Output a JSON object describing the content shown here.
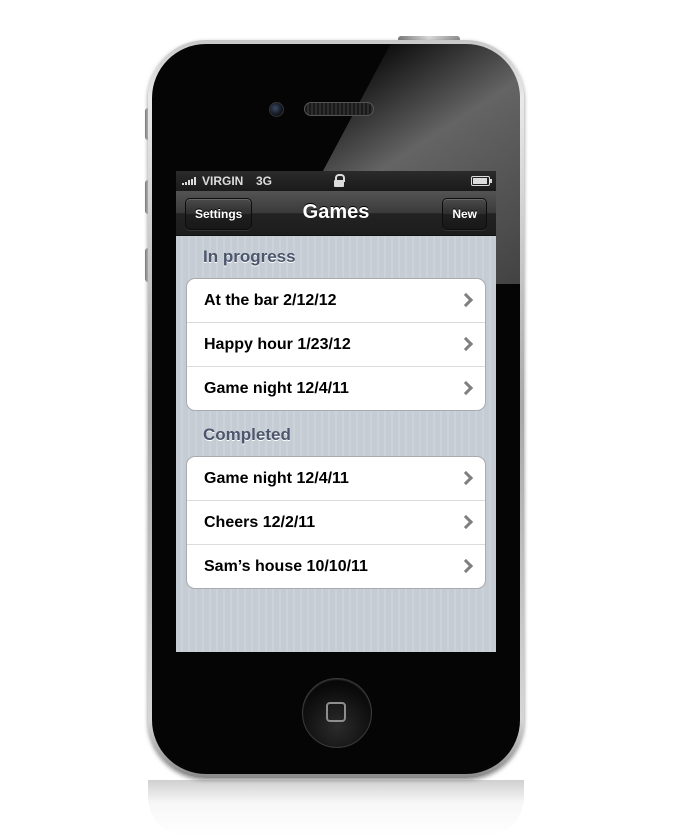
{
  "status_bar": {
    "carrier": "VIRGIN",
    "network": "3G"
  },
  "nav_bar": {
    "title": "Games",
    "left_button": "Settings",
    "right_button": "New"
  },
  "sections": [
    {
      "header": "In progress",
      "rows": [
        {
          "label": "At the bar 2/12/12"
        },
        {
          "label": "Happy hour 1/23/12"
        },
        {
          "label": "Game night 12/4/11"
        }
      ]
    },
    {
      "header": "Completed",
      "rows": [
        {
          "label": "Game night 12/4/11"
        },
        {
          "label": "Cheers 12/2/11"
        },
        {
          "label": "Sam’s house 10/10/11"
        }
      ]
    }
  ],
  "icons": [
    "signal-icon",
    "lock-icon",
    "battery-icon",
    "chevron-right-icon",
    "home-button-icon"
  ]
}
